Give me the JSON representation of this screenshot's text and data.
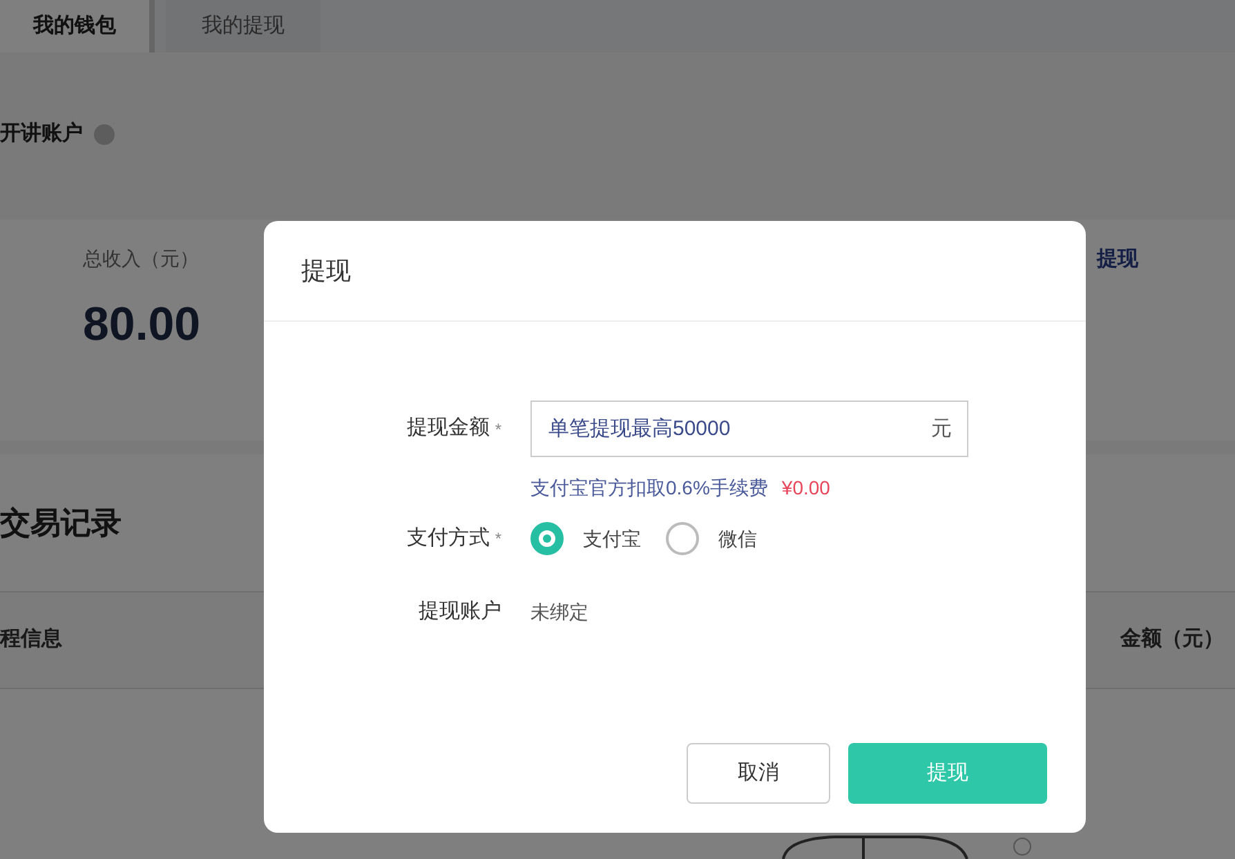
{
  "tabs": [
    {
      "label": "我的钱包",
      "selected": true
    },
    {
      "label": "我的提现",
      "selected": false
    }
  ],
  "account": {
    "title": "开讲账户"
  },
  "summary": {
    "label": "总收入（元）",
    "value": "80.00",
    "action": "提现"
  },
  "records": {
    "title": "交易记录",
    "columns": [
      "程信息",
      "金额（元）"
    ]
  },
  "dialog": {
    "title": "提现",
    "amount": {
      "label": "提现金额",
      "mark": "*",
      "placeholder": "单笔提现最高50000",
      "unit": "元",
      "hint": "支付宝官方扣取0.6%手续费",
      "fee": "¥0.00"
    },
    "payment": {
      "label": "支付方式",
      "mark": "*",
      "options": [
        {
          "label": "支付宝",
          "selected": true
        },
        {
          "label": "微信",
          "selected": false
        }
      ]
    },
    "account": {
      "label": "提现账户",
      "value": "未绑定"
    },
    "buttons": [
      {
        "label": "取消",
        "kind": "secondary"
      },
      {
        "label": "提现",
        "kind": "primary"
      }
    ]
  }
}
